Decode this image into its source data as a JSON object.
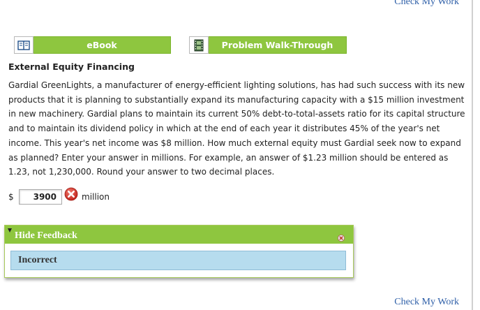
{
  "header": {
    "check_link": "Check My Work"
  },
  "toolbar": {
    "ebook_label": "eBook",
    "walkthrough_label": "Problem Walk-Through"
  },
  "question": {
    "title": "External Equity Financing",
    "body": "Gardial GreenLights, a manufacturer of energy-efficient lighting solutions, has had such success with its new products that it is planning to substantially expand its manufacturing capacity with a $15 million investment in new machinery. Gardial plans to maintain its current 50% debt-to-total-assets ratio for its capital structure and to maintain its dividend policy in which at the end of each year it distributes 45% of the year's net income. This year's net income was $8 million. How much external equity must Gardial seek now to expand as planned? Enter your answer in millions. For example, an answer of $1.23 million should be entered as 1.23, not 1,230,000. Round your answer to two decimal places."
  },
  "answer": {
    "currency": "$",
    "value": "3900",
    "unit": "million",
    "status_icon": "incorrect-x-icon"
  },
  "feedback": {
    "toggle_label": "Hide Feedback",
    "status": "Incorrect"
  },
  "footer": {
    "check_link": "Check My Work"
  },
  "colors": {
    "accent_green": "#8ec63f",
    "link_blue": "#2e5fa8",
    "feedback_blue": "#b6dcee",
    "error_red": "#d9322b"
  }
}
